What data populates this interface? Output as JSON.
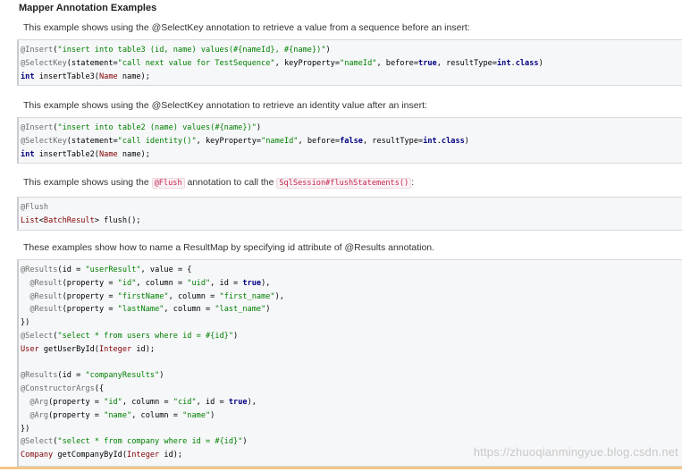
{
  "heading": "Mapper Annotation Examples",
  "desc1": "This example shows using the @SelectKey annotation to retrieve a value from a sequence before an insert:",
  "desc2": "This example shows using the @SelectKey annotation to retrieve an identity value after an insert:",
  "desc3": {
    "before": "This example shows using the ",
    "code1": "@Flush",
    "middle": " annotation to call the ",
    "code2": "SqlSession#flushStatements()",
    "after": ":"
  },
  "desc4": "These examples show how to name a ResultMap by specifying id attribute of @Results annotation.",
  "code1": [
    "@Insert(\"insert into table3 (id, name) values(#{nameId}, #{name})\")",
    "@SelectKey(statement=\"call next value for TestSequence\", keyProperty=\"nameId\", before=true, resultType=int.class)",
    "int insertTable3(Name name);"
  ],
  "code2": [
    "@Insert(\"insert into table2 (name) values(#{name})\")",
    "@SelectKey(statement=\"call identity()\", keyProperty=\"nameId\", before=false, resultType=int.class)",
    "int insertTable2(Name name);"
  ],
  "code3": [
    "@Flush",
    "List<BatchResult> flush();"
  ],
  "code4": [
    "@Results(id = \"userResult\", value = {",
    "  @Result(property = \"id\", column = \"uid\", id = true),",
    "  @Result(property = \"firstName\", column = \"first_name\"),",
    "  @Result(property = \"lastName\", column = \"last_name\")",
    "})",
    "@Select(\"select * from users where id = #{id}\")",
    "User getUserById(Integer id);",
    "",
    "@Results(id = \"companyResults\")",
    "@ConstructorArgs({",
    "  @Arg(property = \"id\", column = \"cid\", id = true),",
    "  @Arg(property = \"name\", column = \"name\")",
    "})",
    "@Select(\"select * from company where id = #{id}\")",
    "Company getCompanyById(Integer id);"
  ],
  "watermark": "https://zhuoqianmingyue.blog.csdn.net"
}
